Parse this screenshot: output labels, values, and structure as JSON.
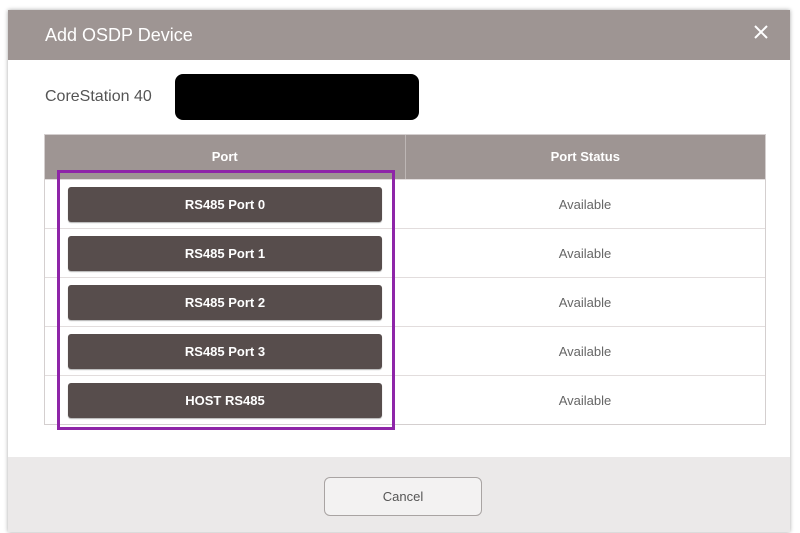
{
  "dialog": {
    "title": "Add OSDP Device",
    "close_icon": "close-icon"
  },
  "device": {
    "name": "CoreStation 40",
    "redacted": true
  },
  "table": {
    "headers": [
      "Port",
      "Port Status"
    ],
    "rows": [
      {
        "port": "RS485 Port 0",
        "status": "Available"
      },
      {
        "port": "RS485 Port 1",
        "status": "Available"
      },
      {
        "port": "RS485 Port 2",
        "status": "Available"
      },
      {
        "port": "RS485 Port 3",
        "status": "Available"
      },
      {
        "port": "HOST RS485",
        "status": "Available"
      }
    ]
  },
  "footer": {
    "cancel_label": "Cancel"
  },
  "colors": {
    "header_bg": "#9e9593",
    "port_button_bg": "#574d4c",
    "highlight_border": "#8e25a8",
    "footer_bg": "#ebe9e9"
  }
}
